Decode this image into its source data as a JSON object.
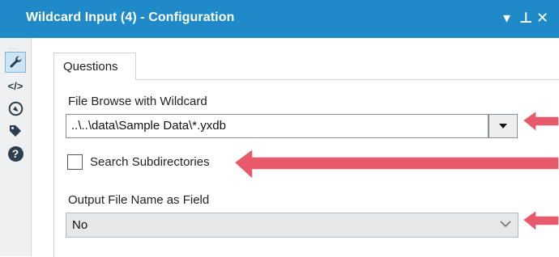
{
  "window": {
    "title": "Wildcard Input (4) - Configuration",
    "controls": {
      "menu_icon": "chevron-down-icon",
      "pin_icon": "pin-icon",
      "close_icon": "close-icon",
      "menu_glyph": "▾",
      "pin_glyph": "⊥",
      "close_glyph": "✕"
    }
  },
  "sidebar": {
    "grip": "···",
    "items": [
      {
        "name": "configuration",
        "icon": "wrench-icon",
        "active": true
      },
      {
        "name": "code",
        "icon": "code-icon",
        "glyph": "</>",
        "active": false
      },
      {
        "name": "annotation",
        "icon": "annotation-icon",
        "active": false
      },
      {
        "name": "tag",
        "icon": "tag-icon",
        "active": false
      },
      {
        "name": "help",
        "icon": "help-icon",
        "glyph": "?",
        "active": false
      }
    ]
  },
  "tabs": [
    {
      "label": "Questions",
      "active": true
    }
  ],
  "form": {
    "file_browse": {
      "label": "File Browse with Wildcard",
      "value": "..\\..\\data\\Sample Data\\*.yxdb"
    },
    "search_subdirectories": {
      "label": "Search Subdirectories",
      "checked": false
    },
    "output_field": {
      "label": "Output File Name as Field",
      "selected": "No"
    }
  },
  "colors": {
    "titlebar": "#1e8bc8",
    "arrow": "#e8596b",
    "sidebar_icon": "#2d3e4e"
  }
}
